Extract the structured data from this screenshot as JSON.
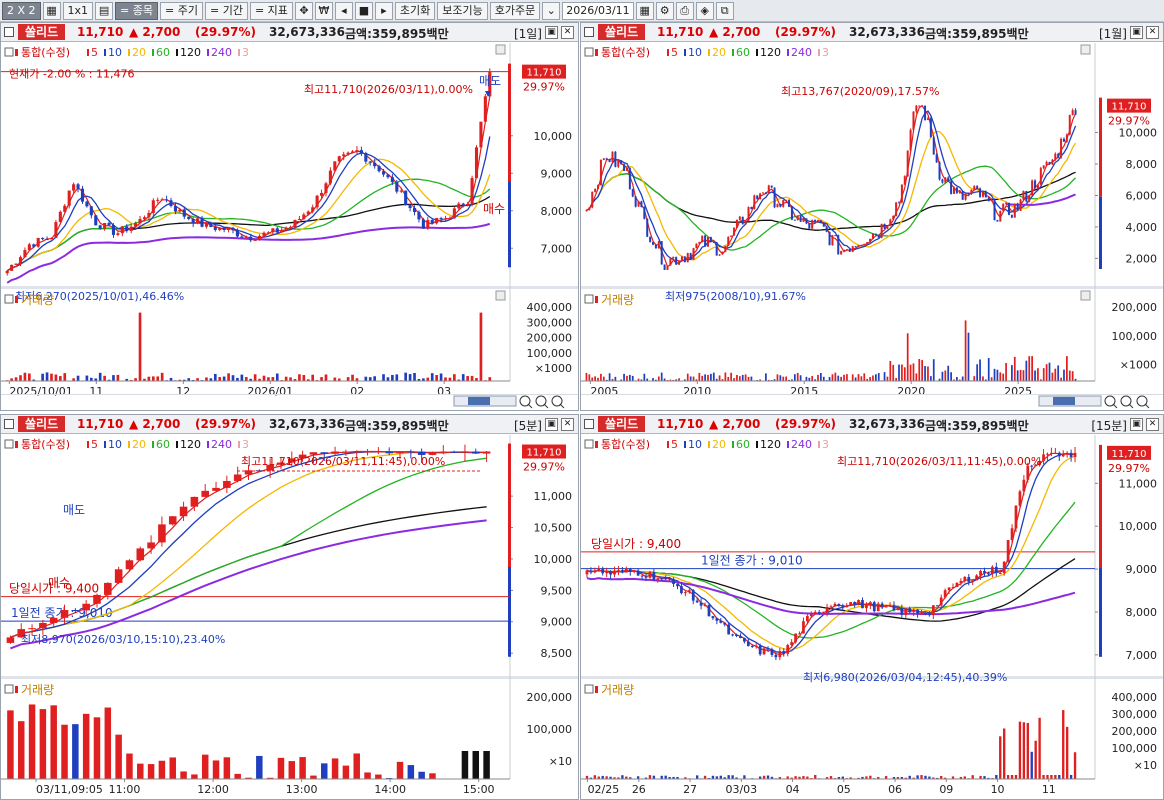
{
  "toolbar": {
    "layout": "2 X 2",
    "items": [
      "1x1",
      "= 종목",
      "= 주기",
      "= 기간",
      "= 지표",
      "초기화",
      "보조기능",
      "호가주문"
    ],
    "date": "2026/03/11"
  },
  "stock": {
    "name": "쏠리드",
    "price": "11,710",
    "change": "▲ 2,700",
    "rate": "(29.97%)",
    "volume": "32,673,336",
    "amount": "금액:359,895백만"
  },
  "legend": {
    "label": "통합(수정)",
    "ma": [
      "5",
      "10",
      "20",
      "60",
      "120",
      "240",
      "3"
    ]
  },
  "volume_label": "거래량",
  "price_tag": {
    "value": "11,710",
    "rate": "29.97%"
  },
  "panes": [
    {
      "period": "[1일]",
      "high_label": "최고11,710(2026/03/11),0.00%",
      "low_label": "최저6,270(2025/10/01),46.46%",
      "current_label": "현재가 -2.00 % : 11,476",
      "sell_label": "매도",
      "buy_label": "매수",
      "y_ticks": [
        "10,000",
        "9,000",
        "8,000",
        "7,000"
      ],
      "vol_ticks": [
        "400,000",
        "300,000",
        "200,000",
        "100,000",
        "×1000"
      ],
      "x_ticks": [
        "2025/10/01",
        "11",
        "12",
        "2026/01",
        "02",
        "03"
      ]
    },
    {
      "period": "[1월]",
      "high_label": "최고13,767(2020/09),17.57%",
      "low_label": "최저975(2008/10),91.67%",
      "y_ticks": [
        "10,000",
        "8,000",
        "6,000",
        "4,000",
        "2,000"
      ],
      "vol_ticks": [
        "200,000",
        "100,000",
        "×1000"
      ],
      "x_ticks": [
        "2005",
        "2010",
        "2015",
        "2020",
        "2025"
      ]
    },
    {
      "period": "[5분]",
      "high_label": "최고11,710(2026/03/11,11:45),0.00%",
      "low_label": "최저8,970(2026/03/10,15:10),23.40%",
      "open_label": "당일시가 : 9,400",
      "prev_label": "1일전 종가 : 9,010",
      "sell_label": "매도",
      "buy_label": "매수",
      "y_ticks": [
        "11,000",
        "10,500",
        "10,000",
        "9,500",
        "9,000",
        "8,500"
      ],
      "vol_ticks": [
        "200,000",
        "100,000",
        "×10"
      ],
      "x_ticks": [
        "03/11,09:05",
        "11:00",
        "12:00",
        "13:00",
        "14:00",
        "15:00"
      ]
    },
    {
      "period": "[15분]",
      "high_label": "최고11,710(2026/03/11,11:45),0.00%",
      "low_label": "최저6,980(2026/03/04,12:45),40.39%",
      "open_label": "당일시가 : 9,400",
      "prev_label": "1일전 종가 : 9,010",
      "y_ticks": [
        "11,000",
        "10,000",
        "9,000",
        "8,000",
        "7,000"
      ],
      "vol_ticks": [
        "400,000",
        "300,000",
        "200,000",
        "100,000",
        "×10"
      ],
      "x_ticks": [
        "02/25",
        "26",
        "27",
        "03/03",
        "04",
        "05",
        "06",
        "09",
        "10",
        "11"
      ]
    }
  ],
  "colors": {
    "up": "#e02020",
    "down": "#1f3fbf",
    "ma5": "#e02020",
    "ma10": "#1f3fbf",
    "ma20": "#f5b800",
    "ma60": "#22b422",
    "ma120": "#111111",
    "ma240": "#8a2be2",
    "ma3": "#f0a0a0"
  }
}
